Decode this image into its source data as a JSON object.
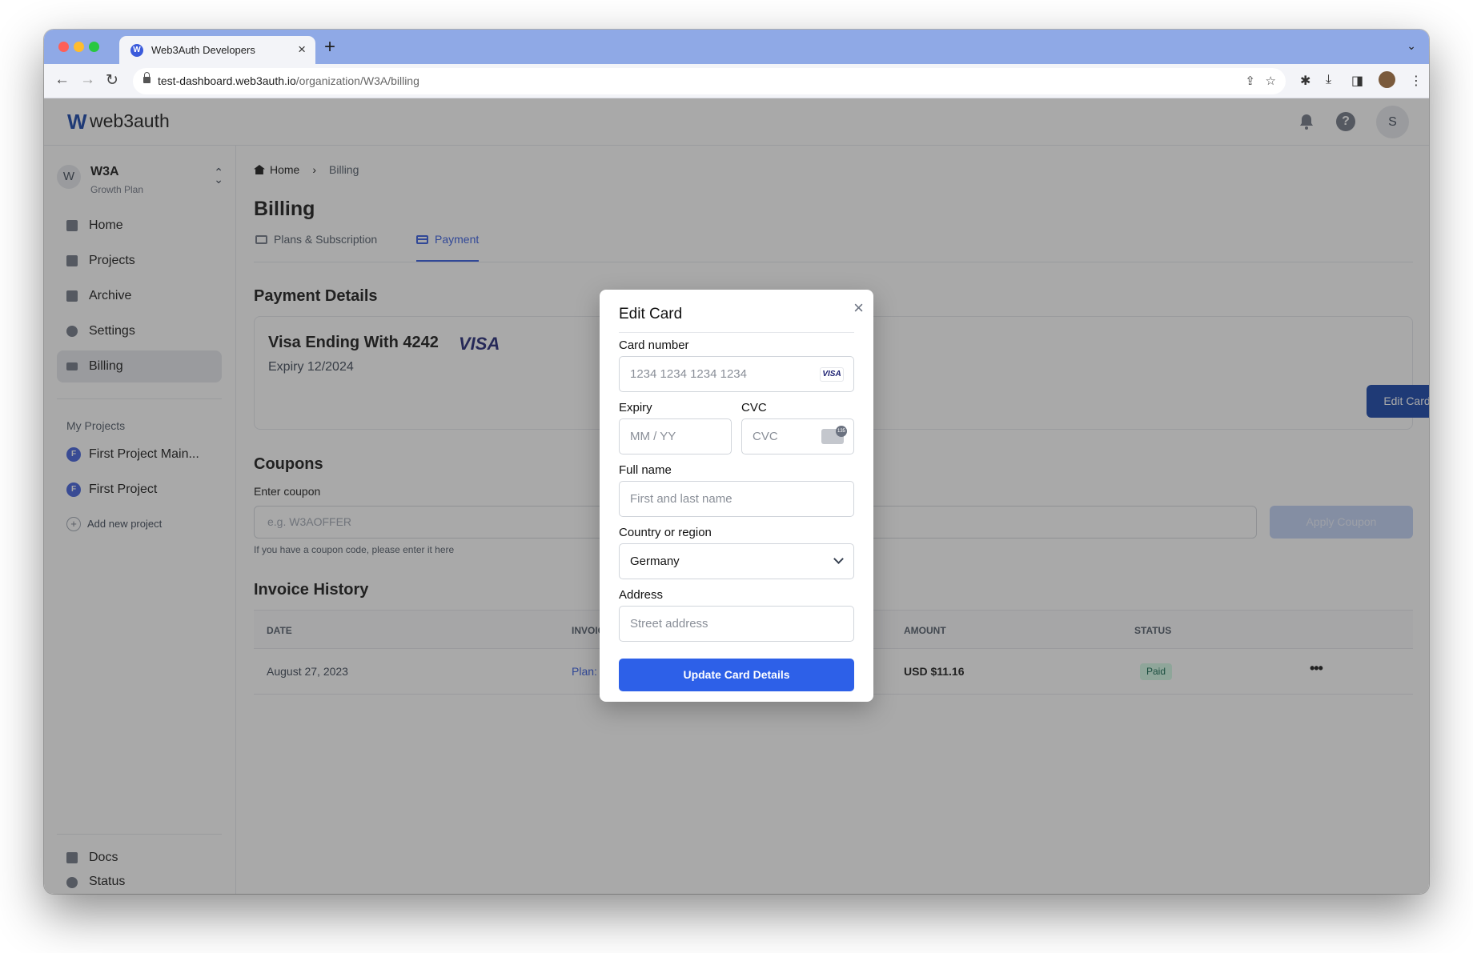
{
  "browser": {
    "tab_title": "Web3Auth Developers",
    "tab_favicon": "W",
    "url_host": "test-dashboard.web3auth.io",
    "url_path": "/organization/W3A/billing"
  },
  "header": {
    "logo_text": "web3auth",
    "logo_mark": "W",
    "avatar_initial": "S"
  },
  "sidebar": {
    "org": {
      "initial": "W",
      "name": "W3A",
      "plan": "Growth Plan"
    },
    "nav": [
      {
        "label": "Home",
        "icon": "home-icon"
      },
      {
        "label": "Projects",
        "icon": "document-icon"
      },
      {
        "label": "Archive",
        "icon": "archive-icon"
      },
      {
        "label": "Settings",
        "icon": "gear-icon"
      },
      {
        "label": "Billing",
        "icon": "credit-card-icon",
        "active": true
      }
    ],
    "projects_title": "My Projects",
    "projects": [
      {
        "badge": "F",
        "label": "First Project Main..."
      },
      {
        "badge": "F",
        "label": "First Project"
      }
    ],
    "add_project_label": "Add new project",
    "footer": [
      {
        "label": "Docs",
        "icon": "document-icon"
      },
      {
        "label": "Status",
        "icon": "check-circle-icon"
      }
    ]
  },
  "main": {
    "breadcrumb": {
      "home": "Home",
      "current": "Billing"
    },
    "title": "Billing",
    "tabs": [
      {
        "label": "Plans & Subscription",
        "active": false
      },
      {
        "label": "Payment",
        "active": true
      }
    ],
    "payment_details": {
      "title": "Payment Details",
      "card_title": "Visa Ending With 4242",
      "brand": "VISA",
      "expiry": "Expiry 12/2024",
      "edit_button": "Edit Card"
    },
    "coupons": {
      "title": "Coupons",
      "label": "Enter coupon",
      "placeholder": "e.g. W3AOFFER",
      "apply_button": "Apply Coupon",
      "help": "If you have a coupon code, please enter it here"
    },
    "invoices": {
      "title": "Invoice History",
      "columns": [
        "DATE",
        "INVOICE",
        "AMOUNT",
        "STATUS"
      ],
      "rows": [
        {
          "date": "August 27, 2023",
          "invoice": "Plan:",
          "amount": "USD $11.16",
          "status": "Paid"
        }
      ]
    }
  },
  "modal": {
    "title": "Edit Card",
    "card_number": {
      "label": "Card number",
      "placeholder": "1234 1234 1234 1234",
      "brand": "VISA"
    },
    "expiry": {
      "label": "Expiry",
      "placeholder": "MM / YY"
    },
    "cvc": {
      "label": "CVC",
      "placeholder": "CVC"
    },
    "full_name": {
      "label": "Full name",
      "placeholder": "First and last name"
    },
    "country": {
      "label": "Country or region",
      "value": "Germany"
    },
    "address": {
      "label": "Address",
      "placeholder": "Street address"
    },
    "submit": "Update Card Details"
  }
}
